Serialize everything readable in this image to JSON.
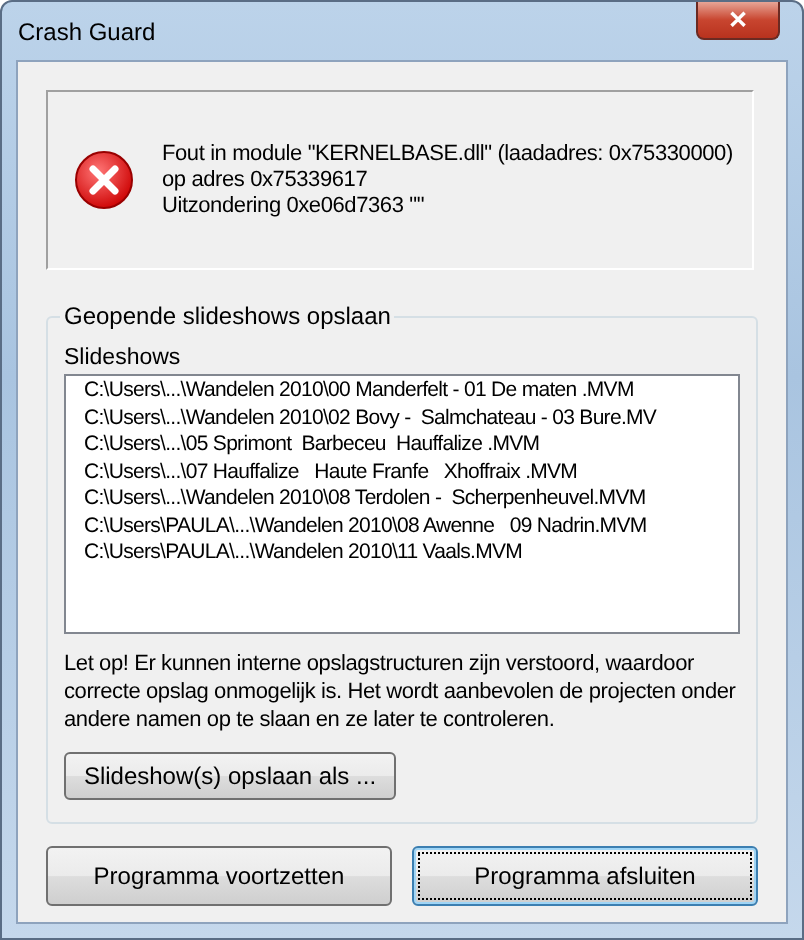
{
  "window": {
    "title": "Crash Guard",
    "close": "✕"
  },
  "error": {
    "lines": [
      "Fout in module \"KERNELBASE.dll\" (laadadres: 0x75330000)",
      "op adres 0x75339617",
      "Uitzondering 0xe06d7363 \"\""
    ]
  },
  "group": {
    "title": "Geopende slideshows opslaan",
    "list_label": "Slideshows",
    "items": [
      "C:\\Users\\...\\Wandelen 2010\\00 Manderfelt - 01 De maten .MVM",
      "C:\\Users\\...\\Wandelen 2010\\02 Bovy -  Salmchateau - 03 Bure.MV",
      "C:\\Users\\...\\05 Sprimont  Barbeceu  Hauffalize .MVM",
      "C:\\Users\\...\\07 Hauffalize   Haute Franfe   Xhoffraix .MVM",
      "C:\\Users\\...\\Wandelen 2010\\08 Terdolen -  Scherpenheuvel.MVM",
      "C:\\Users\\PAULA\\...\\Wandelen 2010\\08 Awenne   09 Nadrin.MVM",
      "C:\\Users\\PAULA\\...\\Wandelen 2010\\11 Vaals.MVM"
    ],
    "warning": "Let op! Er kunnen interne opslagstructuren zijn verstoord, waardoor correcte opslag onmogelijk is. Het wordt aanbevolen de projecten onder andere namen op te slaan en ze later te controleren.",
    "save_button": "Slideshow(s) opslaan als ..."
  },
  "buttons": [
    {
      "label": "Programma voortzetten",
      "focused": false
    },
    {
      "label": "Programma afsluiten",
      "focused": true
    }
  ]
}
